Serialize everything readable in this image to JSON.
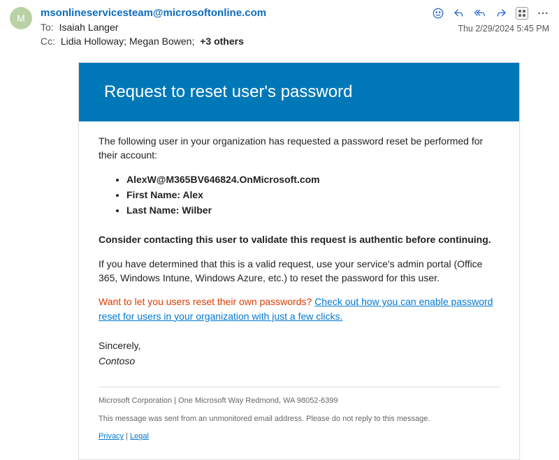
{
  "header": {
    "avatarInitial": "M",
    "sender": "msonlineservicesteam@microsoftonline.com",
    "toLabel": "To:",
    "toValue": "Isaiah Langer",
    "ccLabel": "Cc:",
    "ccValue": "Lidia Holloway;   Megan Bowen;",
    "ccExtra": "+3 others",
    "timestamp": "Thu 2/29/2024 5:45 PM"
  },
  "body": {
    "bannerTitle": "Request to reset user's password",
    "intro": "The following user in your organization has requested a password reset be performed for their account:",
    "bullets": [
      "AlexW@M365BV646824.OnMicrosoft.com",
      "First Name: Alex",
      "Last Name: Wilber"
    ],
    "warn": "Consider contacting this user to validate this request is authentic before continuing.",
    "valid": "If you have determined that this is a valid request, use your service's admin portal (Office 365, Windows Intune, Windows Azure, etc.) to reset the password for this user.",
    "promoRed": "Want to let you users reset their own passwords? ",
    "promoLink": "Check out how you can enable password reset for users in your organization with just a few clicks.",
    "signoff": "Sincerely,",
    "company": "Contoso",
    "footerCorp": "Microsoft Corporation | One Microsoft Way Redmond, WA 98052-6399",
    "footerNote": "This message was sent from an unmonitored email address. Please do not reply to this message.",
    "footerPrivacy": "Privacy",
    "footerSep": " | ",
    "footerLegal": "Legal"
  }
}
